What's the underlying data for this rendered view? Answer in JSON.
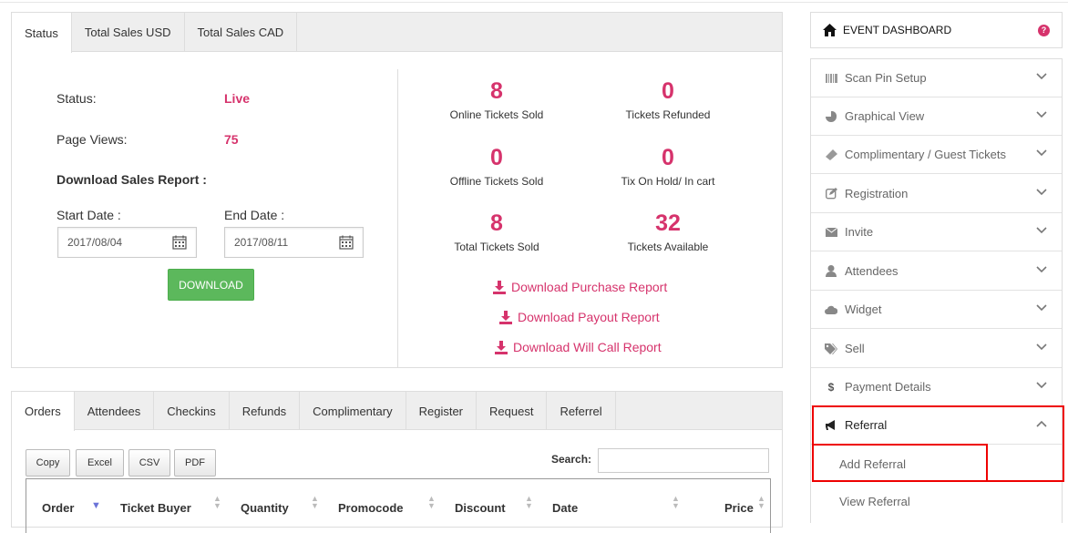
{
  "status_tabs": [
    "Status",
    "Total Sales USD",
    "Total Sales CAD"
  ],
  "status": {
    "status_label": "Status:",
    "status_value": "Live",
    "views_label": "Page Views:",
    "views_value": "75",
    "report_heading": "Download Sales Report :",
    "start_label": "Start Date :",
    "end_label": "End Date :",
    "start_date": "2017/08/04",
    "end_date": "2017/08/11",
    "download_label": "DOWNLOAD"
  },
  "stats": [
    {
      "value": "8",
      "caption": "Online Tickets Sold"
    },
    {
      "value": "0",
      "caption": "Tickets Refunded"
    },
    {
      "value": "0",
      "caption": "Offline Tickets Sold"
    },
    {
      "value": "0",
      "caption": "Tix On Hold/ In cart"
    },
    {
      "value": "8",
      "caption": "Total Tickets Sold"
    },
    {
      "value": "32",
      "caption": "Tickets Available"
    }
  ],
  "download_links": [
    "Download Purchase Report",
    "Download Payout Report",
    "Download Will Call Report"
  ],
  "orders_tabs": [
    "Orders",
    "Attendees",
    "Checkins",
    "Refunds",
    "Complimentary",
    "Register",
    "Request",
    "Referrel"
  ],
  "export_buttons": [
    "Copy",
    "Excel",
    "CSV",
    "PDF"
  ],
  "search_label": "Search:",
  "table_headers": [
    "Order",
    "Ticket Buyer",
    "Quantity",
    "Promocode",
    "Discount",
    "Date",
    "Price"
  ],
  "sidebar": {
    "header": "EVENT DASHBOARD",
    "help": "?",
    "items": [
      {
        "label": "Scan Pin Setup",
        "icon": "barcode-icon"
      },
      {
        "label": "Graphical View",
        "icon": "pie-chart-icon"
      },
      {
        "label": "Complimentary / Guest Tickets",
        "icon": "ticket-icon"
      },
      {
        "label": "Registration",
        "icon": "edit-icon"
      },
      {
        "label": "Invite",
        "icon": "envelope-icon"
      },
      {
        "label": "Attendees",
        "icon": "user-icon"
      },
      {
        "label": "Widget",
        "icon": "cloud-icon"
      },
      {
        "label": "Sell",
        "icon": "tags-icon"
      },
      {
        "label": "Payment Details",
        "icon": "dollar-icon"
      },
      {
        "label": "Referral",
        "icon": "bullhorn-icon"
      }
    ],
    "sub_items": [
      "Add Referral",
      "View Referral"
    ]
  },
  "colors": {
    "accent": "#d6336c",
    "download_button": "#5cb85c",
    "highlight": "#ee0000"
  }
}
